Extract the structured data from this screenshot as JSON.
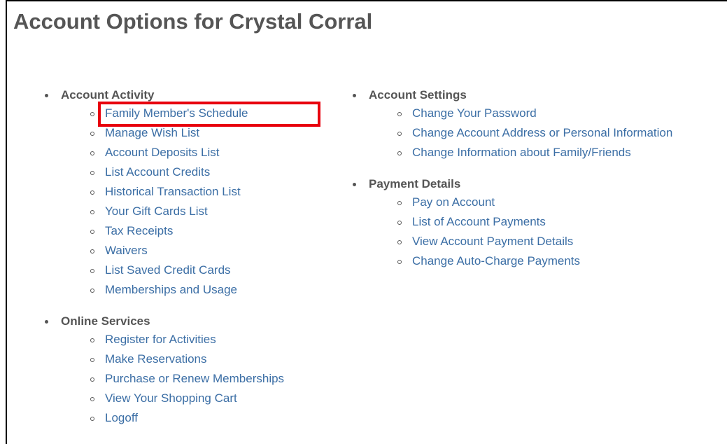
{
  "page": {
    "title": "Account Options for Crystal Corral"
  },
  "sections_left": [
    {
      "heading": "Account Activity",
      "links": [
        "Family Member's Schedule",
        "Manage Wish List",
        "Account Deposits List",
        "List Account Credits",
        "Historical Transaction List",
        "Your Gift Cards List",
        "Tax Receipts",
        "Waivers",
        "List Saved Credit Cards",
        "Memberships and Usage"
      ]
    },
    {
      "heading": "Online Services",
      "links": [
        "Register for Activities",
        "Make Reservations",
        "Purchase or Renew Memberships",
        "View Your Shopping Cart",
        "Logoff"
      ]
    }
  ],
  "sections_right": [
    {
      "heading": "Account Settings",
      "links": [
        "Change Your Password",
        "Change Account Address or Personal Information",
        "Change Information about Family/Friends"
      ]
    },
    {
      "heading": "Payment Details",
      "links": [
        "Pay on Account",
        "List of Account Payments",
        "View Account Payment Details",
        "Change Auto-Charge Payments"
      ]
    }
  ],
  "highlighted_link": "Family Member's Schedule",
  "colors": {
    "link": "#3b6ea5",
    "heading": "#555555",
    "highlight_box": "#e8000d"
  }
}
